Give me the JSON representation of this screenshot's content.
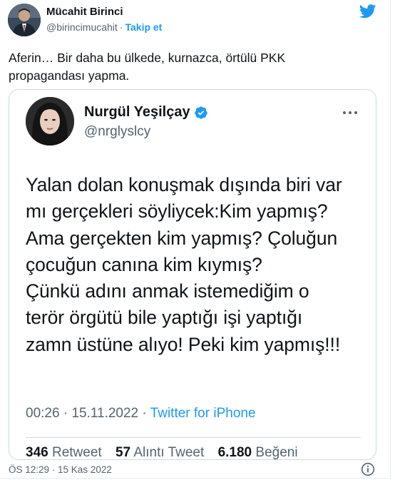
{
  "author": {
    "name": "Mücahit Birinci",
    "handle": "@birincimucahit",
    "separator": "·",
    "follow_label": "Takip et"
  },
  "tweet": {
    "text": "Aferin… Bir daha bu ülkede, kurnazca, örtülü PKK propagandası yapma."
  },
  "embedded": {
    "name": "Nurgül Yeşilçay",
    "handle": "@nrglyslcy",
    "verified": true,
    "text_lines": [
      "Yalan dolan konuşmak dışında biri var",
      "mı gerçekleri söyliycek:Kim yapmış?",
      "Ama gerçekten kim yapmış? Çoluğun",
      "çocuğun canına kim kıymış?",
      "Çünkü adını anmak istemediğim o",
      "terör örgütü bile yaptığı işi yaptığı",
      "zamn üstüne alıyo! Peki kim yapmış!!!"
    ],
    "time": "00:26",
    "date": "15.11.2022",
    "meta_separator": "·",
    "source": "Twitter for iPhone",
    "stats": {
      "retweets_count": "346",
      "retweets_label": "Retweet",
      "quotes_count": "57",
      "quotes_label": "Alıntı Tweet",
      "likes_count": "6.180",
      "likes_label": "Beğeni"
    }
  },
  "footer": {
    "timestamp": "ÖS 12:29 · 15 Kas 2022"
  },
  "colors": {
    "accent": "#1d9bf0",
    "muted": "#536471",
    "text": "#0f1419",
    "border": "#cfd9de"
  },
  "icons": {
    "brand": "twitter-bird-icon",
    "verified": "verified-badge-icon",
    "more": "more-icon",
    "info": "info-icon"
  }
}
